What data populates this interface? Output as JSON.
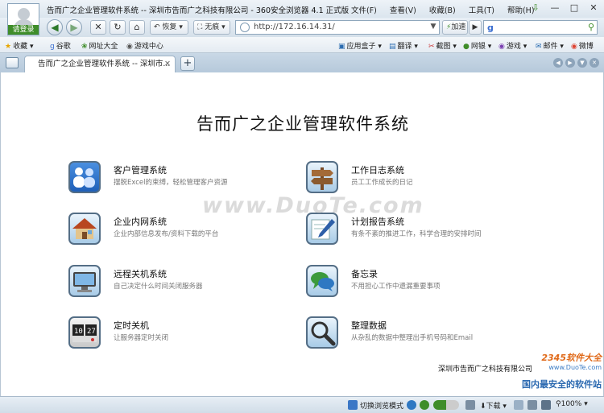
{
  "window": {
    "title": "告而广之企业管理软件系统 -- 深圳市告而广之科技有限公司 - 360安全浏览器 4.1 正式版",
    "login_label": "请登录",
    "menu": [
      "文件(F)",
      "查看(V)",
      "收藏(B)",
      "工具(T)",
      "帮助(H)"
    ],
    "controls": [
      "⇩",
      "—",
      "□",
      "✕"
    ]
  },
  "toolbar": {
    "restore_label": "恢复",
    "traceless_label": "无痕",
    "address": "http://172.16.14.31/",
    "accelerate_label": "加速",
    "search_engine_letter": "g",
    "search_placeholder": ""
  },
  "favorites": {
    "left": [
      "收藏",
      "谷歌",
      "网址大全",
      "游戏中心"
    ],
    "right": [
      "应用盒子",
      "翻译",
      "截图",
      "网银",
      "游戏",
      "邮件",
      "微博"
    ]
  },
  "tabs": {
    "active_label": "告而广之企业管理软件系统 -- 深圳市..."
  },
  "page": {
    "title": "告而广之企业管理软件系统",
    "modules": [
      {
        "name": "客户管理系统",
        "desc": "摆脱Excel的束缚，轻松管理客户资源",
        "icon": "users-icon"
      },
      {
        "name": "工作日志系统",
        "desc": "员工工作成长的日记",
        "icon": "signpost-icon"
      },
      {
        "name": "企业内网系统",
        "desc": "企业内部信息发布/资料下载的平台",
        "icon": "house-icon"
      },
      {
        "name": "计划报告系统",
        "desc": "有条不紊的推进工作，科学合理的安排时间",
        "icon": "pencil-icon"
      },
      {
        "name": "远程关机系统",
        "desc": "自己决定什么时间关闭服务器",
        "icon": "monitor-icon"
      },
      {
        "name": "备忘录",
        "desc": "不用担心工作中遗漏重要事项",
        "icon": "chat-bubble-icon"
      },
      {
        "name": "定时关机",
        "desc": "让服务器定时关闭",
        "icon": "clock-icon"
      },
      {
        "name": "整理数据",
        "desc": "从杂乱的数据中整理出手机号码和Email",
        "icon": "magnifier-icon"
      }
    ],
    "company": "深圳市告而广之科技有限公司",
    "watermark": "www.DuoTe.com",
    "corner_logo": {
      "line1": "2345软件大全",
      "line2": "www.DuoTe.com",
      "line3": "国内最安全的软件站"
    }
  },
  "statusbar": {
    "switch_mode_label": "切换浏览模式",
    "download_label": "下载",
    "zoom": "100%"
  },
  "colors": {
    "accent_green": "#3f8d2a",
    "chrome_blue": "#c9d8e6",
    "icon_frame": "#546e86"
  }
}
